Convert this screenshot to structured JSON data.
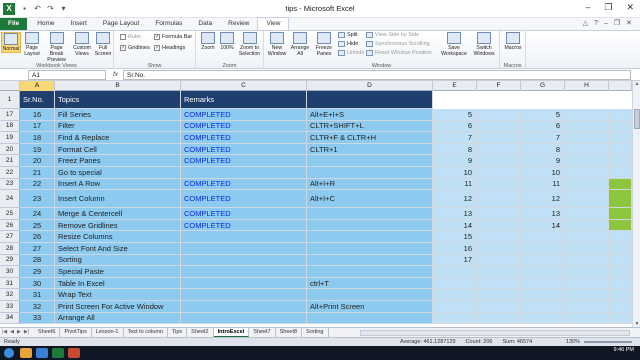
{
  "window": {
    "title": "tips - Microsoft Excel",
    "minimize": "–",
    "restore": "❐",
    "close": "✕"
  },
  "ribbon": {
    "tabs": [
      "File",
      "Home",
      "Insert",
      "Page Layout",
      "Formulas",
      "Data",
      "Review",
      "View"
    ],
    "active_tab": "View",
    "groups": {
      "workbook_views": {
        "label": "Workbook Views",
        "buttons": [
          "Normal",
          "Page Layout",
          "Page Break Preview",
          "Custom Views",
          "Full Screen"
        ]
      },
      "show": {
        "label": "Show",
        "ruler": "Ruler",
        "gridlines": "Gridlines",
        "formula_bar": "Formula Bar",
        "headings": "Headings"
      },
      "zoom": {
        "label": "Zoom",
        "buttons": [
          "Zoom",
          "100%",
          "Zoom to Selection"
        ]
      },
      "window": {
        "label": "Window",
        "buttons": [
          "New Window",
          "Arrange All",
          "Freeze Panes"
        ],
        "split": "Split",
        "hide": "Hide",
        "unhide": "Unhide",
        "view_side": "View Side by Side",
        "sync_scroll": "Synchronous Scrolling",
        "reset_pos": "Reset Window Position",
        "save_ws": "Save Workspace",
        "switch": "Switch Windows"
      },
      "macros": {
        "label": "Macros",
        "buttons": [
          "Macros"
        ]
      }
    }
  },
  "formula_bar": {
    "name_box": "A1",
    "fx": "fx",
    "content": "Sr.No."
  },
  "columns": [
    "A",
    "B",
    "C",
    "D",
    "E",
    "F",
    "G",
    "H"
  ],
  "header_row": {
    "row": "1",
    "sr": "Sr.No.",
    "topic": "Topics",
    "remarks": "Remarks"
  },
  "rows": [
    {
      "r": "17",
      "sr": "16",
      "topic": "Fill Series",
      "remark": "COMPLETED",
      "d": "Alt+E+I+S",
      "e": "5",
      "g": "5"
    },
    {
      "r": "18",
      "sr": "17",
      "topic": "Filter",
      "remark": "COMPLETED",
      "d": "CLTR+SHIFT+L",
      "e": "6",
      "g": "6"
    },
    {
      "r": "19",
      "sr": "18",
      "topic": "Find & Replace",
      "remark": "COMPLETED",
      "d": "CLTR+F & CLTR+H",
      "e": "7",
      "g": "7"
    },
    {
      "r": "20",
      "sr": "19",
      "topic": "Format Cell",
      "remark": "COMPLETED",
      "d": "CLTR+1",
      "e": "8",
      "g": "8"
    },
    {
      "r": "21",
      "sr": "20",
      "topic": "Freez Panes",
      "remark": "COMPLETED",
      "d": "",
      "e": "9",
      "g": "9"
    },
    {
      "r": "22",
      "sr": "21",
      "topic": "Go to special",
      "remark": "",
      "d": "",
      "e": "10",
      "g": "10"
    },
    {
      "r": "23",
      "sr": "22",
      "topic": "Insert A Row",
      "remark": "COMPLETED",
      "d": "Alt+I+R",
      "e": "11",
      "g": "11"
    },
    {
      "r": "24",
      "sr": "23",
      "topic": "Insert Column",
      "remark": "COMPLETED",
      "d": "Alt+I+C",
      "e": "12",
      "g": "12"
    },
    {
      "r": "25",
      "sr": "24",
      "topic": "Merge & Centercell",
      "remark": "COMPLETED",
      "d": "",
      "e": "13",
      "g": "13"
    },
    {
      "r": "26",
      "sr": "25",
      "topic": "Remove Gridlines",
      "remark": "COMPLETED",
      "d": "",
      "e": "14",
      "g": "14"
    },
    {
      "r": "27",
      "sr": "26",
      "topic": "Resize Columns",
      "remark": "",
      "d": "",
      "e": "15",
      "g": ""
    },
    {
      "r": "28",
      "sr": "27",
      "topic": "Select Font And Size",
      "remark": "",
      "d": "",
      "e": "16",
      "g": ""
    },
    {
      "r": "29",
      "sr": "28",
      "topic": "Sorting",
      "remark": "",
      "d": "",
      "e": "17",
      "g": ""
    },
    {
      "r": "30",
      "sr": "29",
      "topic": "Special Paste",
      "remark": "",
      "d": "",
      "e": "",
      "g": ""
    },
    {
      "r": "31",
      "sr": "30",
      "topic": "Table In Excel",
      "remark": "",
      "d": "ctrl+T",
      "e": "",
      "g": ""
    },
    {
      "r": "32",
      "sr": "31",
      "topic": "Wrap Text",
      "remark": "",
      "d": "",
      "e": "",
      "g": ""
    },
    {
      "r": "33",
      "sr": "32",
      "topic": "Print Screen For Active Window",
      "remark": "",
      "d": "Alt+Print Screen",
      "e": "",
      "g": ""
    },
    {
      "r": "34",
      "sr": "33",
      "topic": "Arrange All",
      "remark": "",
      "d": "",
      "e": "",
      "g": ""
    }
  ],
  "sheet_tabs": [
    "Sheet6",
    "PivotTips",
    "Lesson-1",
    "Text to column",
    "Tips",
    "Sheet2",
    "IntroExcel",
    "Sheet7",
    "Sheet8",
    "Sorting"
  ],
  "active_sheet": "IntroExcel",
  "status": {
    "ready": "Ready",
    "average": "Average: 461.1287129",
    "count": "Count: 206",
    "sum": "Sum: 46574",
    "zoom": "130%"
  },
  "taskbar": {
    "time": "9:46 PM"
  },
  "colors": {
    "header_fill": "#1f3f6e",
    "cell_fill": "#8ccaf0",
    "status_text": "#0b29d8",
    "excel_green": "#1d7a3a"
  }
}
